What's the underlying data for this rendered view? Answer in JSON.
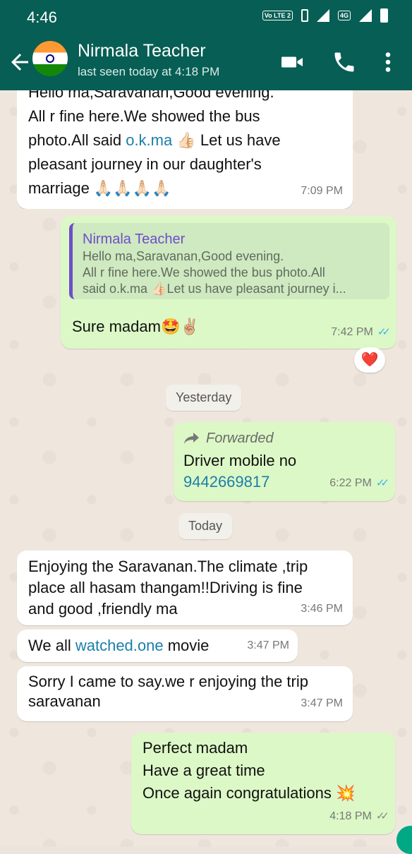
{
  "status_bar": {
    "time": "4:46",
    "volte": "Vo LTE 2",
    "network": "4G"
  },
  "header": {
    "contact_name": "Nirmala Teacher",
    "last_seen": "last seen today at 4:18 PM",
    "icons": [
      "back-arrow-icon",
      "video-call-icon",
      "voice-call-icon",
      "more-options-icon"
    ]
  },
  "messages": {
    "m1": {
      "text_a": "Hello ma,Saravanan,Good evening.\nAll r fine here.We showed the bus\nphoto.All said ",
      "link": "o.k.ma",
      "text_b": " 👍🏻 Let us have\npleasant journey in our daughter's\nmarriage 🙏🏻🙏🏻🙏🏻🙏🏻",
      "time": "7:09 PM"
    },
    "m2": {
      "quote_name": "Nirmala Teacher",
      "quote_text": "Hello ma,Saravanan,Good evening.\nAll r fine here.We showed the bus photo.All\nsaid o.k.ma 👍🏻Let us have pleasant journey i...",
      "text": "Sure madam🤩✌🏼",
      "time": "7:42 PM",
      "reaction": "❤️"
    },
    "date_yesterday": "Yesterday",
    "m3": {
      "forwarded": "Forwarded",
      "text": "Driver mobile no",
      "link": "9442669817",
      "time": "6:22 PM"
    },
    "date_today": "Today",
    "m4": {
      "text": "Enjoying the Saravanan.The climate ,trip\nplace all hasam thangam!!Driving is fine\nand good ,friendly ma",
      "time": "3:46 PM"
    },
    "m5": {
      "text_a": "We all ",
      "link": "watched.one",
      "text_b": " movie",
      "time": "3:47 PM"
    },
    "m6": {
      "text": "Sorry I came to say.we r enjoying the trip\nsaravanan",
      "time": "3:47 PM"
    },
    "m7": {
      "text": "Perfect madam\nHave a great time\nOnce again congratulations 💥",
      "time": "4:18 PM"
    }
  },
  "colors": {
    "header": "#075e54",
    "incoming": "#ffffff",
    "outgoing": "#dcf8c6",
    "link": "#1b7fa8",
    "read_ticks": "#34b7f1"
  }
}
